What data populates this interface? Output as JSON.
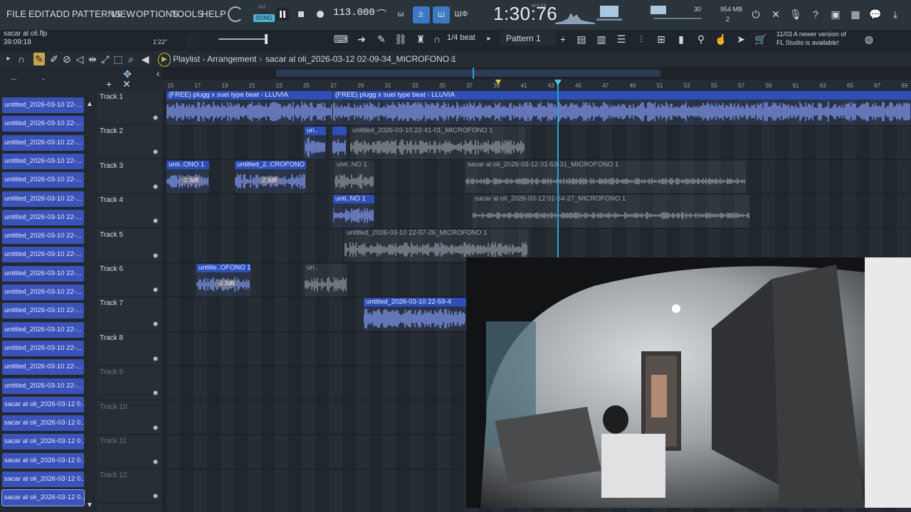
{
  "menu": [
    "FILE",
    "EDIT",
    "ADD",
    "PATTERNS",
    "VIEW",
    "OPTIONS",
    "TOOLS",
    "HELP"
  ],
  "project": {
    "file": "sacar al oli.flp",
    "elapsed": "39:09:18"
  },
  "transport": {
    "mode_top": "PAT",
    "mode_bottom": "SONG",
    "tempo": "113.000",
    "time": "1:30:76",
    "time_label": "M:S:CS",
    "time_small": "1'22\""
  },
  "monitor": {
    "cpu_value": "30",
    "ram": "954 MB",
    "voices": "2"
  },
  "toolbar": {
    "snap": "1/4 beat",
    "pattern": "Pattern 1"
  },
  "notice": {
    "date": "11/03",
    "line1": "A newer version of",
    "line2": "FL Studio is available!"
  },
  "playlist": {
    "title": "Playlist - Arrangement",
    "crumb": "sacar al oli_2026-03-12 02-09-34_MICROFONO 1"
  },
  "browser_items": [
    "untitled_2026-03-10 22-...",
    "untitled_2026-03-10 22-...",
    "untitled_2026-03-10 22-...",
    "untitled_2026-03-10 22-...",
    "untitled_2026-03-10 22-...",
    "untitled_2026-03-10 22-...",
    "untitled_2026-03-10 22-...",
    "untitled_2026-03-10 22-...",
    "untitled_2026-03-10 22-...",
    "untitled_2026-03-10 22-...",
    "untitled_2026-03-10 22-...",
    "untitled_2026-03-10 22-...",
    "untitled_2026-03-10 22-...",
    "untitled_2026-03-10 22-...",
    "untitled_2026-03-10 22-...",
    "untitled_2026-03-10 22-...",
    "sacar al oli_2026-03-12 0...",
    "sacar al oli_2026-03-12 0...",
    "sacar al oli_2026-03-12 0...",
    "sacar al oli_2026-03-12 0...",
    "sacar al oli_2026-03-12 0...",
    "sacar al oli_2026-03-12 0..."
  ],
  "tracks": [
    "Track 1",
    "Track 2",
    "Track 3",
    "Track 4",
    "Track 5",
    "Track 6",
    "Track 7",
    "Track 8",
    "Track 9",
    "Track 10",
    "Track 11",
    "Track 12"
  ],
  "ruler": [
    "15",
    "17",
    "19",
    "21",
    "23",
    "25",
    "27",
    "29",
    "31",
    "33",
    "35",
    "37",
    "39",
    "41",
    "43",
    "45",
    "47",
    "49",
    "51",
    "53",
    "55",
    "57",
    "59",
    "61",
    "63",
    "65",
    "67",
    "69"
  ],
  "clips": {
    "t1a": "(FREE) plugg x suei type beat - LLUVIA",
    "t1b": "(FREE) plugg x suei type beat - LLUVIA",
    "t2a": "un..",
    "t2c": "untitled_2026-03-10 22-41-01_MICROFONO 1",
    "t3a": "unti..ONO 1",
    "t3b": "untitled_2..CROFONO 1",
    "t3c": "unti..NO 1",
    "t3d": "sacar al oli_2026-03-12 01-53-31_MICROFONO 1",
    "t4a": "unti..NO 1",
    "t4b": "sacar al oli_2026-03-12 01-54-27_MICROFONO 1",
    "t5a": "untitled_2026-03-10 22-57-26_MICROFONO 1",
    "t6a": "untitle..OFONO 1",
    "t6b": "un..",
    "t7a": "untitled_2026-03-10 22-59-4",
    "gain": "-2.3dB"
  },
  "colors": {
    "accent": "#3b53b8",
    "wave": "#7d93e8",
    "playhead": "#2aa3c9"
  }
}
